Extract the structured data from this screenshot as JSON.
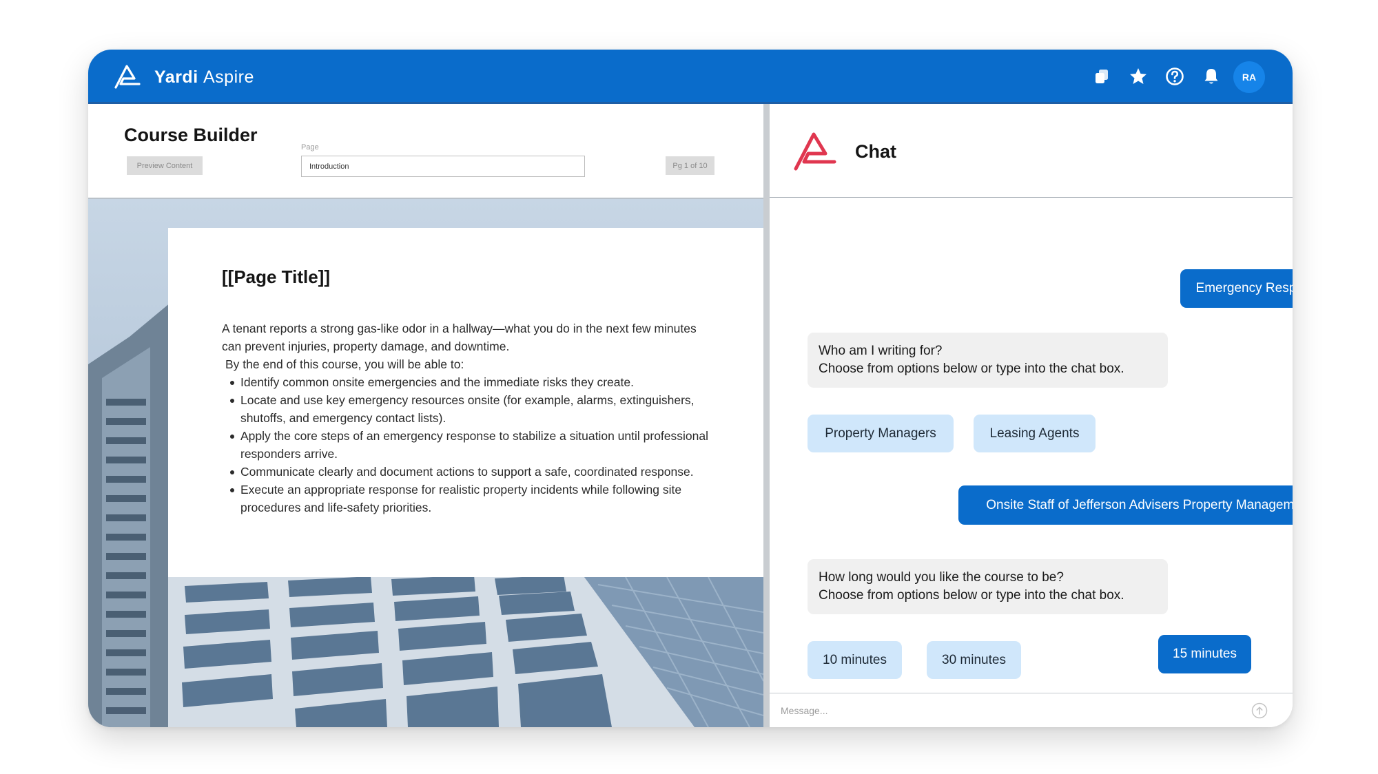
{
  "app": {
    "brand_primary": "Yardi",
    "brand_secondary": "Aspire",
    "accent_color": "#0a6ccb",
    "logo_color_chat": "#e0364f"
  },
  "topbar": {
    "icons": [
      "copy-icon",
      "star-icon",
      "help-icon",
      "bell-icon",
      "search-icon"
    ],
    "avatar_initials": "RA"
  },
  "builder": {
    "title": "Course Builder",
    "preview_button": "Preview Content",
    "page_label": "Page",
    "page_value": "Introduction",
    "page_indicator": "Pg 1 of 10"
  },
  "content": {
    "page_title": "[[Page Title]]",
    "intro": "A tenant reports a strong gas-like odor in a hallway—what you do in the next few minutes can prevent injuries, property damage, and downtime.",
    "intro_sub": "By the end of this course, you will be able to:",
    "objectives": [
      "Identify common onsite emergencies and the immediate risks they create.",
      "Locate and use key emergency resources onsite (for example, alarms, extinguishers, shutoffs, and emergency contact lists).",
      "Apply the core steps of an emergency response to stabilize a situation until professional responders arrive.",
      "Communicate clearly and document actions to support a safe, coordinated response.",
      "Execute an appropriate response for realistic property incidents while following site procedures and life-safety priorities."
    ]
  },
  "chat": {
    "title": "Chat",
    "messages": [
      {
        "role": "user",
        "text": "Emergency Response"
      },
      {
        "role": "bot",
        "line1": "Who am I writing for?",
        "line2": "Choose from options below or type into the chat box."
      },
      {
        "role": "option",
        "text": "Property Managers"
      },
      {
        "role": "option",
        "text": "Leasing Agents"
      },
      {
        "role": "user",
        "text": "Onsite Staff of Jefferson Advisers Property Management"
      },
      {
        "role": "bot",
        "line1": "How long would you like the course to be?",
        "line2": "Choose from options below or type into the chat box."
      },
      {
        "role": "option",
        "text": "10 minutes"
      },
      {
        "role": "option",
        "text": "30 minutes"
      },
      {
        "role": "user",
        "text": "15 minutes"
      }
    ],
    "input_placeholder": "Message..."
  }
}
